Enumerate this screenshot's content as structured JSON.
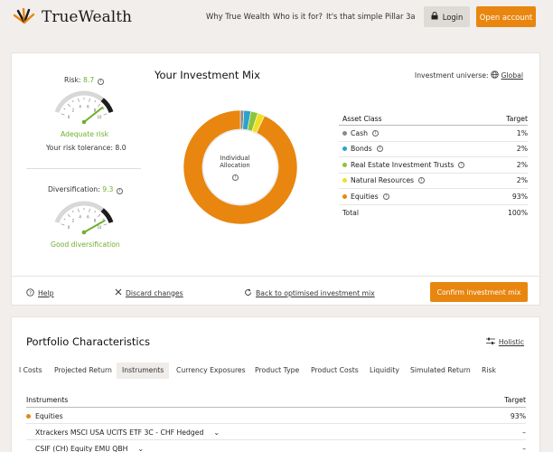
{
  "header": {
    "brand": "TrueWealth",
    "nav": [
      "Why True Wealth",
      "Who is it for?",
      "It's that simple",
      "Pillar 3a"
    ],
    "login_label": "Login",
    "open_account_label": "Open account"
  },
  "mix": {
    "risk": {
      "label": "Risk:",
      "value": "8.7",
      "value_num": 8.7,
      "status": "Adequate risk",
      "tolerance_label": "Your risk tolerance:",
      "tolerance_value": "8.0"
    },
    "diversification": {
      "label": "Diversification:",
      "value": "9.3",
      "value_num": 9.3,
      "status": "Good diversification"
    },
    "gauge_ticks": [
      "0",
      "2",
      "4",
      "6",
      "8",
      "10"
    ],
    "title": "Your Investment Mix",
    "universe_label": "Investment universe:",
    "universe_value": "Global",
    "donut_center": "Individual Allocation",
    "table": {
      "col_asset": "Asset Class",
      "col_target": "Target",
      "rows": [
        {
          "name": "Cash",
          "value": "1%",
          "pct": 1,
          "color": "#8a8a8a"
        },
        {
          "name": "Bonds",
          "value": "2%",
          "pct": 2,
          "color": "#2ea3c9"
        },
        {
          "name": "Real Estate Investment Trusts",
          "value": "2%",
          "pct": 2,
          "color": "#8cc43a"
        },
        {
          "name": "Natural Resources",
          "value": "2%",
          "pct": 2,
          "color": "#f0e020"
        },
        {
          "name": "Equities",
          "value": "93%",
          "pct": 93,
          "color": "#e8860f"
        }
      ],
      "total_label": "Total",
      "total_value": "100%"
    },
    "footer": {
      "help": "Help",
      "discard": "Discard changes",
      "back": "Back to optimised investment mix",
      "confirm": "Confirm investment mix"
    }
  },
  "portfolio": {
    "title": "Portfolio Characteristics",
    "holistic": "Holistic",
    "tabs": [
      "l Costs",
      "Projected Return",
      "Instruments",
      "Currency Exposures",
      "Product Type",
      "Product Costs",
      "Liquidity",
      "Simulated Return",
      "Risk"
    ],
    "active_tab": "Instruments",
    "col_instruments": "Instruments",
    "col_target": "Target",
    "rows": [
      {
        "name": "Equities",
        "value": "93%"
      },
      {
        "name": "Xtrackers MSCI USA UCITS ETF 3C - CHF Hedged",
        "value": "–"
      },
      {
        "name": "CSIF (CH) Equity EMU QBH",
        "value": "–"
      }
    ]
  }
}
